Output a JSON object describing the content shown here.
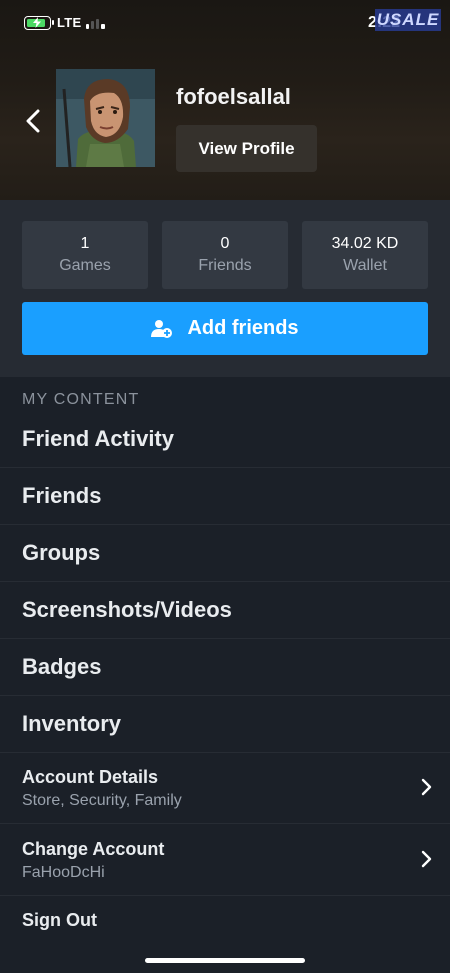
{
  "status_bar": {
    "network": "LTE",
    "time": "2:22",
    "watermark": "USALE"
  },
  "profile": {
    "username": "fofoelsallal",
    "view_profile_label": "View Profile"
  },
  "stats": [
    {
      "value": "1",
      "label": "Games"
    },
    {
      "value": "0",
      "label": "Friends"
    },
    {
      "value": "34.02 KD",
      "label": "Wallet"
    }
  ],
  "add_friends_label": "Add friends",
  "my_content": {
    "title": "MY CONTENT",
    "items": [
      {
        "label": "Friend Activity"
      },
      {
        "label": "Friends"
      },
      {
        "label": "Groups"
      },
      {
        "label": "Screenshots/Videos"
      },
      {
        "label": "Badges"
      },
      {
        "label": "Inventory"
      }
    ]
  },
  "account": {
    "details": {
      "title": "Account Details",
      "subtitle": "Store, Security, Family"
    },
    "change": {
      "title": "Change Account",
      "subtitle": "FaHooDcHi"
    },
    "sign_out": "Sign Out"
  },
  "colors": {
    "accent": "#1a9fff",
    "background": "#1b2028",
    "stat_tile": "#333942"
  }
}
